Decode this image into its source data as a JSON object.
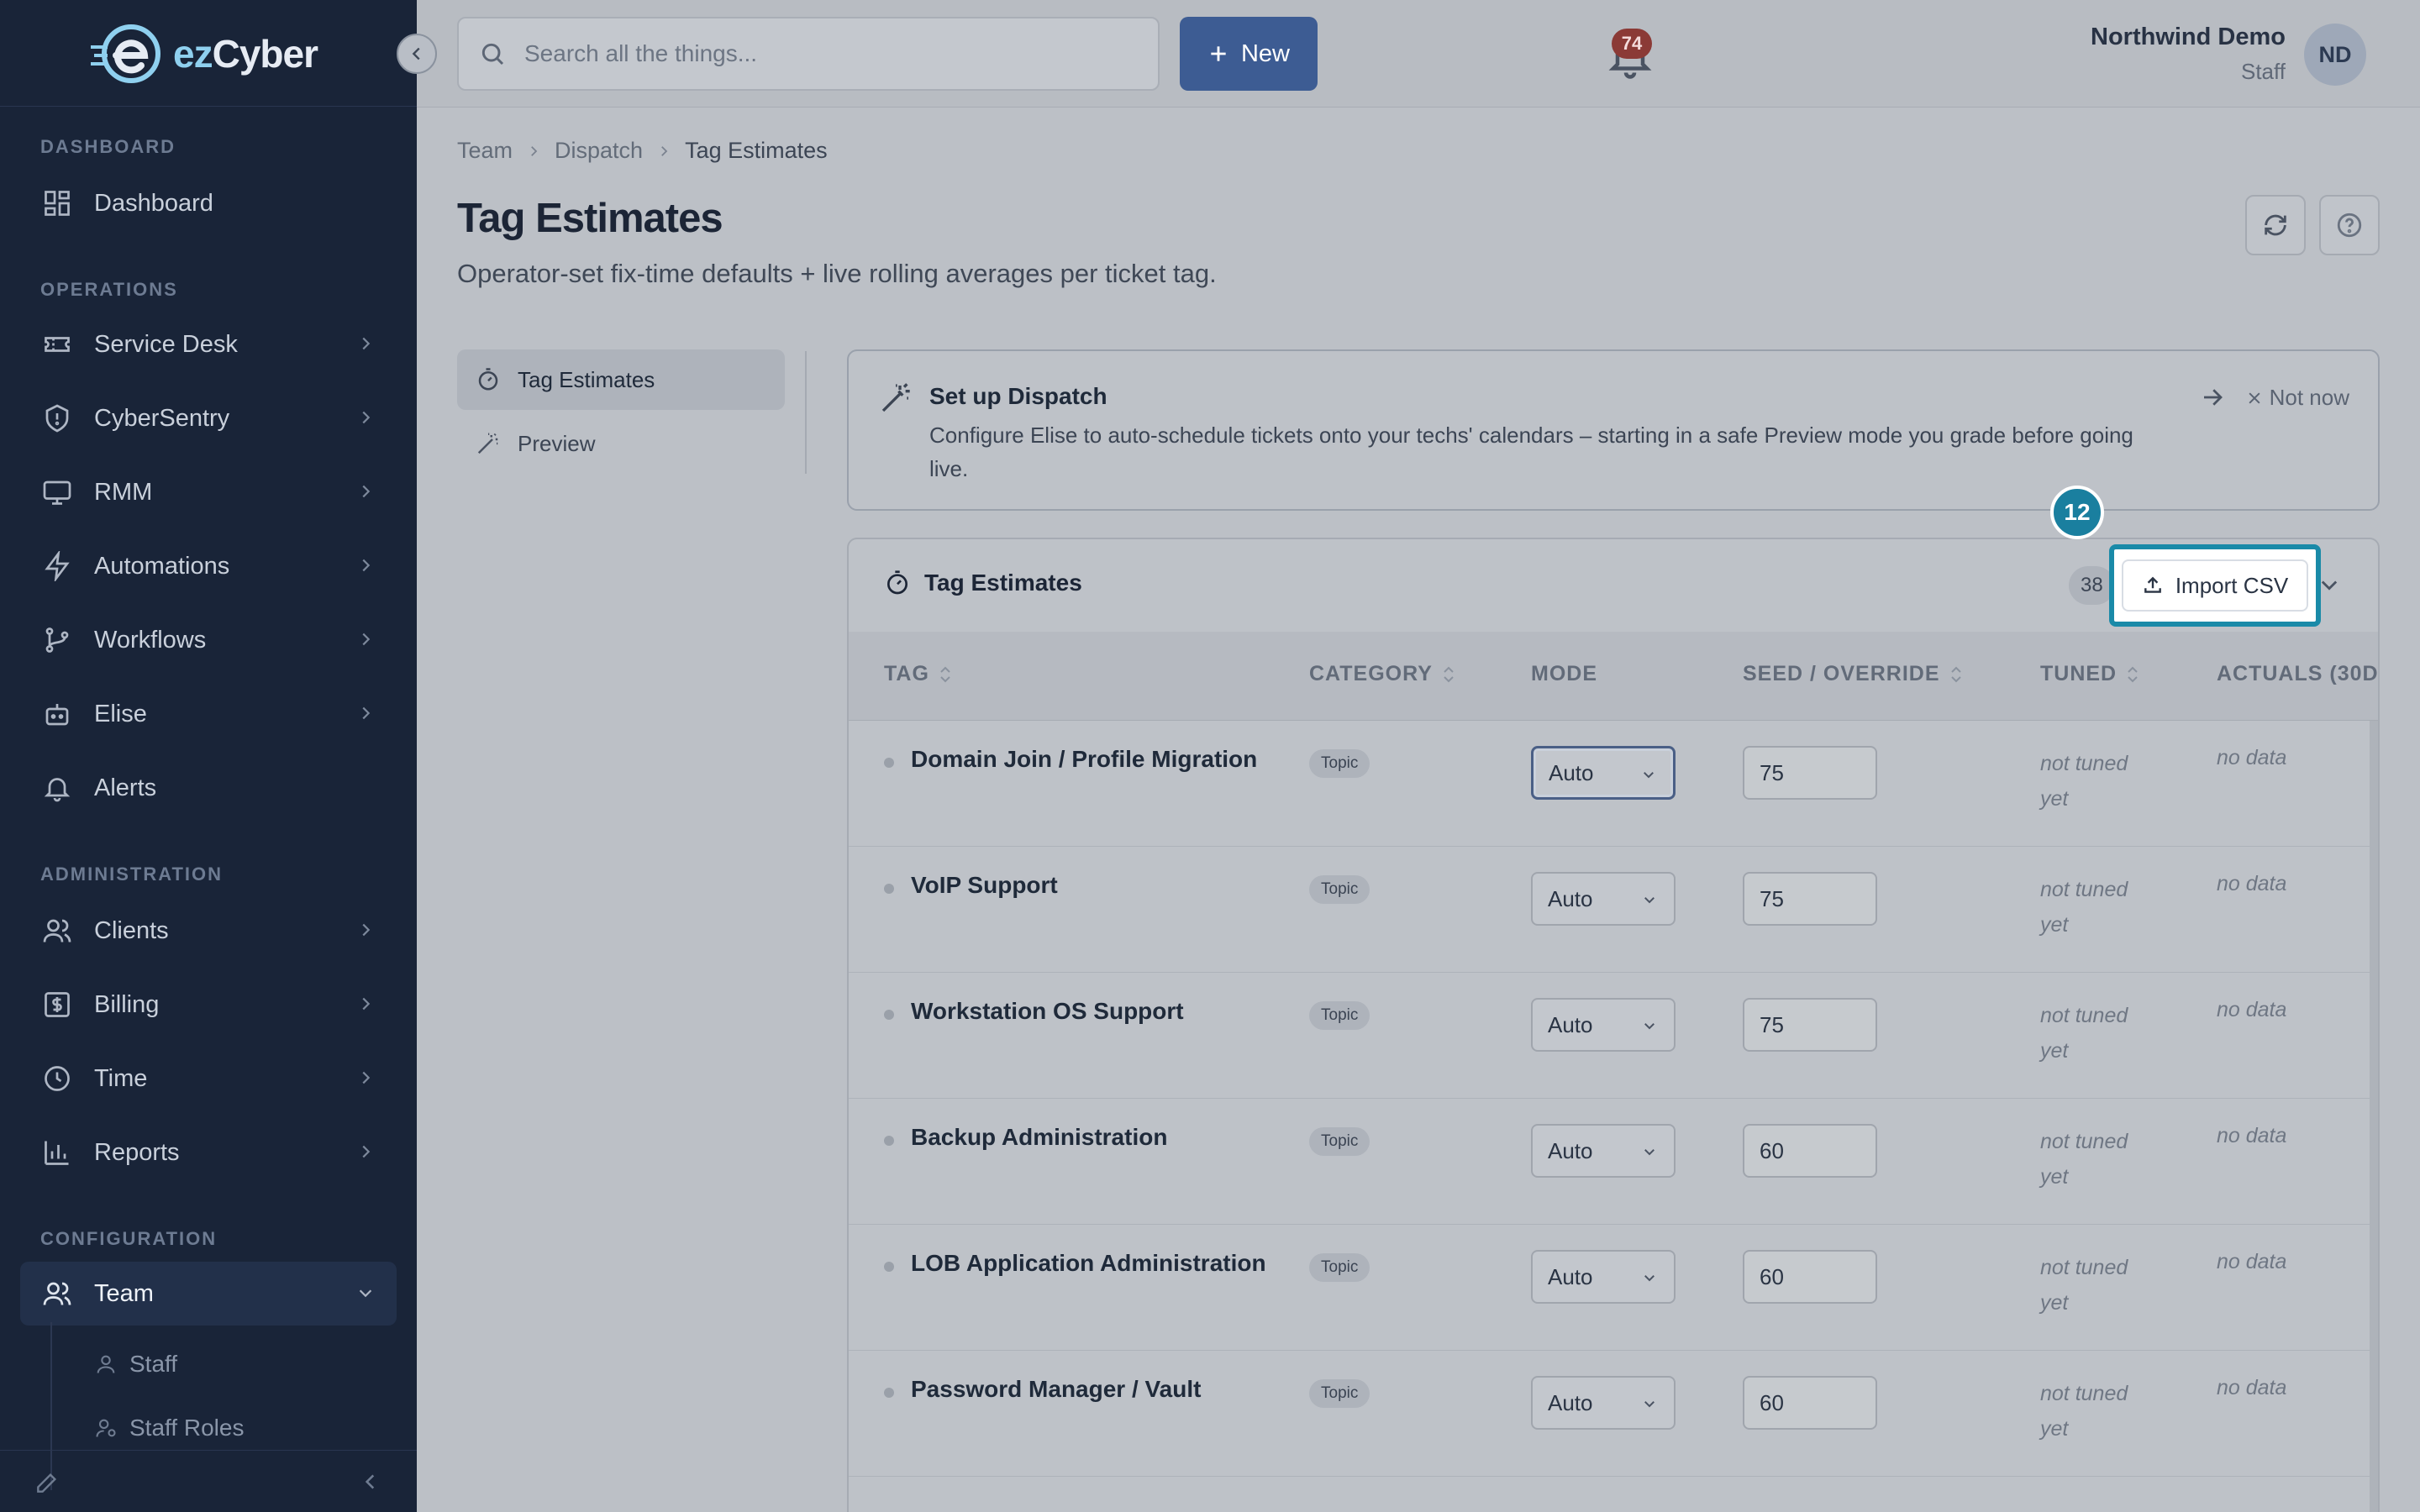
{
  "app": {
    "logo_prefix": "ez",
    "logo_suffix": "Cyber"
  },
  "sidebar": {
    "sections": [
      {
        "label": "DASHBOARD"
      },
      {
        "label": "OPERATIONS"
      },
      {
        "label": "ADMINISTRATION"
      },
      {
        "label": "CONFIGURATION"
      }
    ],
    "items": [
      {
        "label": "Dashboard",
        "icon": "grid-icon"
      },
      {
        "label": "Service Desk",
        "icon": "ticket-icon"
      },
      {
        "label": "CyberSentry",
        "icon": "shield-icon"
      },
      {
        "label": "RMM",
        "icon": "monitor-icon"
      },
      {
        "label": "Automations",
        "icon": "bolt-icon"
      },
      {
        "label": "Workflows",
        "icon": "branch-icon"
      },
      {
        "label": "Elise",
        "icon": "robot-icon"
      },
      {
        "label": "Alerts",
        "icon": "bell-icon"
      },
      {
        "label": "Clients",
        "icon": "users-icon"
      },
      {
        "label": "Billing",
        "icon": "dollar-icon"
      },
      {
        "label": "Time",
        "icon": "clock-icon"
      },
      {
        "label": "Reports",
        "icon": "bar-chart-icon"
      },
      {
        "label": "Team",
        "icon": "team-icon"
      }
    ],
    "sub_items": [
      {
        "label": "Staff"
      },
      {
        "label": "Staff Roles"
      }
    ]
  },
  "topbar": {
    "search_placeholder": "Search all the things...",
    "new_label": "New",
    "notification_count": "74",
    "user_name": "Northwind Demo",
    "user_role": "Staff",
    "avatar_initials": "ND"
  },
  "breadcrumb": [
    "Team",
    "Dispatch",
    "Tag Estimates"
  ],
  "page": {
    "title": "Tag Estimates",
    "subtitle": "Operator-set fix-time defaults + live rolling averages per ticket tag."
  },
  "subnav": [
    {
      "label": "Tag Estimates"
    },
    {
      "label": "Preview"
    }
  ],
  "setup": {
    "title": "Set up Dispatch",
    "description": "Configure Elise to auto-schedule tickets onto your techs' calendars – starting in a safe Preview mode you grade before going live.",
    "dismiss_label": "Not now"
  },
  "panel": {
    "title": "Tag Estimates",
    "count": "38",
    "import_label": "Import CSV",
    "step_number": "12"
  },
  "table": {
    "columns": [
      "TAG",
      "CATEGORY",
      "MODE",
      "SEED / OVERRIDE",
      "TUNED",
      "ACTUALS (30D"
    ],
    "rows": [
      {
        "tag": "Domain Join / Profile Migration",
        "category": "Topic",
        "mode": "Auto",
        "seed": "75",
        "tuned_1": "not tuned",
        "tuned_2": "yet",
        "actuals": "no data"
      },
      {
        "tag": "VoIP Support",
        "category": "Topic",
        "mode": "Auto",
        "seed": "75",
        "tuned_1": "not tuned",
        "tuned_2": "yet",
        "actuals": "no data"
      },
      {
        "tag": "Workstation OS Support",
        "category": "Topic",
        "mode": "Auto",
        "seed": "75",
        "tuned_1": "not tuned",
        "tuned_2": "yet",
        "actuals": "no data"
      },
      {
        "tag": "Backup Administration",
        "category": "Topic",
        "mode": "Auto",
        "seed": "60",
        "tuned_1": "not tuned",
        "tuned_2": "yet",
        "actuals": "no data"
      },
      {
        "tag": "LOB Application Administration",
        "category": "Topic",
        "mode": "Auto",
        "seed": "60",
        "tuned_1": "not tuned",
        "tuned_2": "yet",
        "actuals": "no data"
      },
      {
        "tag": "Password Manager / Vault",
        "category": "Topic",
        "mode": "Auto",
        "seed": "60",
        "tuned_1": "not tuned",
        "tuned_2": "yet",
        "actuals": "no data"
      }
    ]
  },
  "colors": {
    "sidebar_bg": "#192438",
    "accent": "#3d5c93",
    "highlight": "#1a8aa8"
  }
}
